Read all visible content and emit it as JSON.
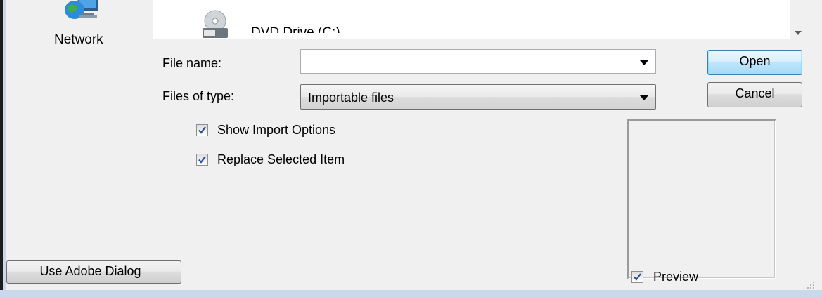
{
  "sidebar": {
    "network_label": "Network",
    "network_icon": "network-globe-icon"
  },
  "file_list": {
    "items": [
      {
        "label": "DVD Drive (C:)",
        "icon": "dvd-drive-icon"
      }
    ]
  },
  "form": {
    "file_name_label": "File name:",
    "file_name_value": "",
    "files_of_type_label": "Files of type:",
    "files_of_type_value": "Importable files"
  },
  "buttons": {
    "open": "Open",
    "cancel": "Cancel",
    "use_adobe_dialog": "Use Adobe Dialog"
  },
  "options": {
    "show_import_options": {
      "label": "Show Import Options",
      "checked": true
    },
    "replace_selected_item": {
      "label": "Replace Selected Item",
      "checked": true
    },
    "preview": {
      "label": "Preview",
      "checked": true
    }
  },
  "colors": {
    "window_bg": "#f0f0f0",
    "frame_blue": "#c9d8ea",
    "checkmark": "#2a4d9b",
    "default_button_border": "#3c7fb1"
  }
}
